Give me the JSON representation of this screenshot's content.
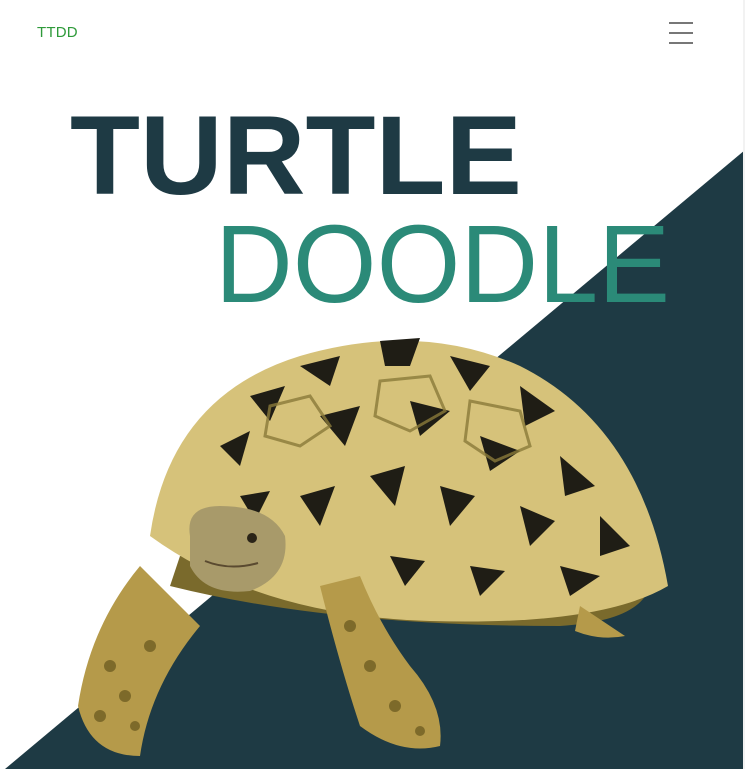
{
  "navbar": {
    "brand": "TTDD",
    "brand_color": "#2e9a3a",
    "menu_icon": "hamburger-menu-icon",
    "menu_icon_color": "#777777"
  },
  "hero": {
    "logo_line1": "TURTLE",
    "logo_line2": "DOODLE",
    "logo_line1_color": "#1e3a44",
    "logo_line2_color": "#2b8a78",
    "background_color": "#1e3a44",
    "image_subject": "leopard tortoise"
  }
}
